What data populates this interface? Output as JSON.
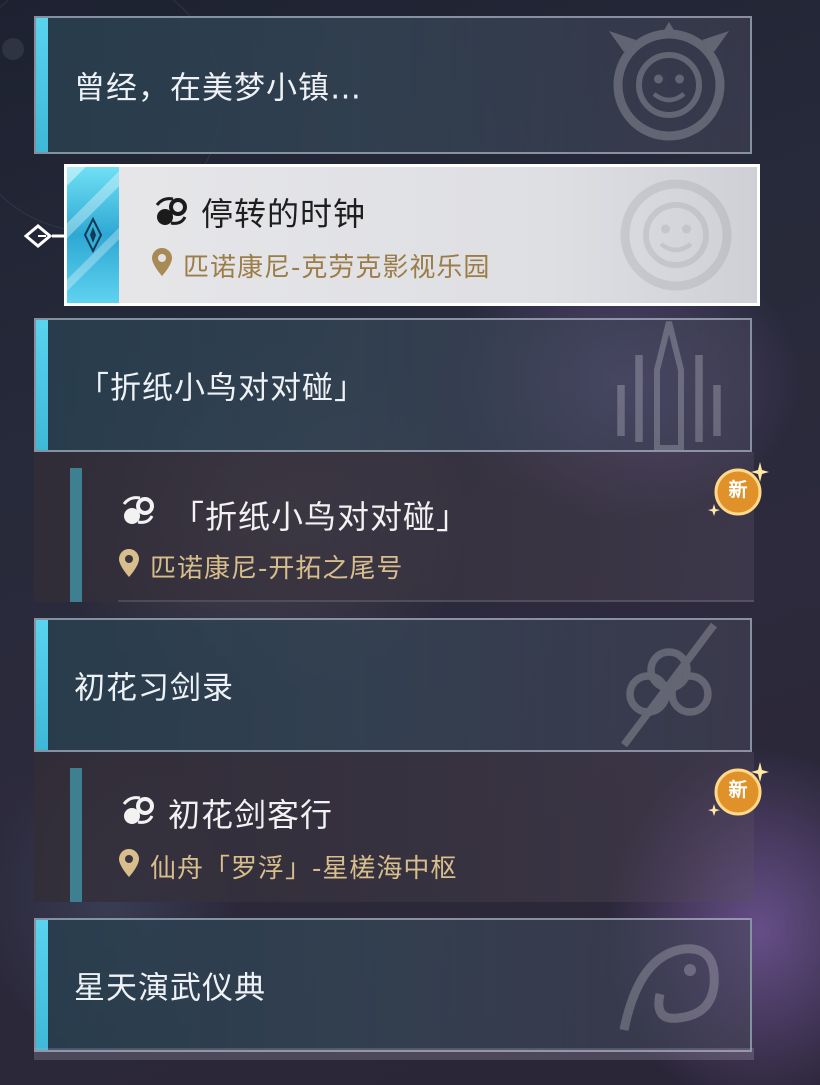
{
  "chapters": [
    {
      "title": "曾经，在美梦小镇…"
    },
    {
      "title": "「折纸小鸟对对碰」"
    },
    {
      "title": "初花习剑录"
    },
    {
      "title": "星天演武仪典"
    }
  ],
  "quests": [
    {
      "title": "停转的时钟",
      "location": "匹诺康尼-克劳克影视乐园",
      "selected": true,
      "is_new": false
    },
    {
      "title": "「折纸小鸟对对碰」",
      "location": "匹诺康尼-开拓之尾号",
      "selected": false,
      "is_new": true
    },
    {
      "title": "初花剑客行",
      "location": "仙舟「罗浮」-星槎海中枢",
      "selected": false,
      "is_new": true
    }
  ],
  "badge_label": "新",
  "colors": {
    "accent": "#59d3ee",
    "location": "#d8be8c",
    "badge": "#e0912a"
  },
  "icons": {
    "quest": "quest-icon",
    "location": "location-pin-icon",
    "selector": "selector-arrow-icon",
    "new": "new-badge-icon"
  }
}
